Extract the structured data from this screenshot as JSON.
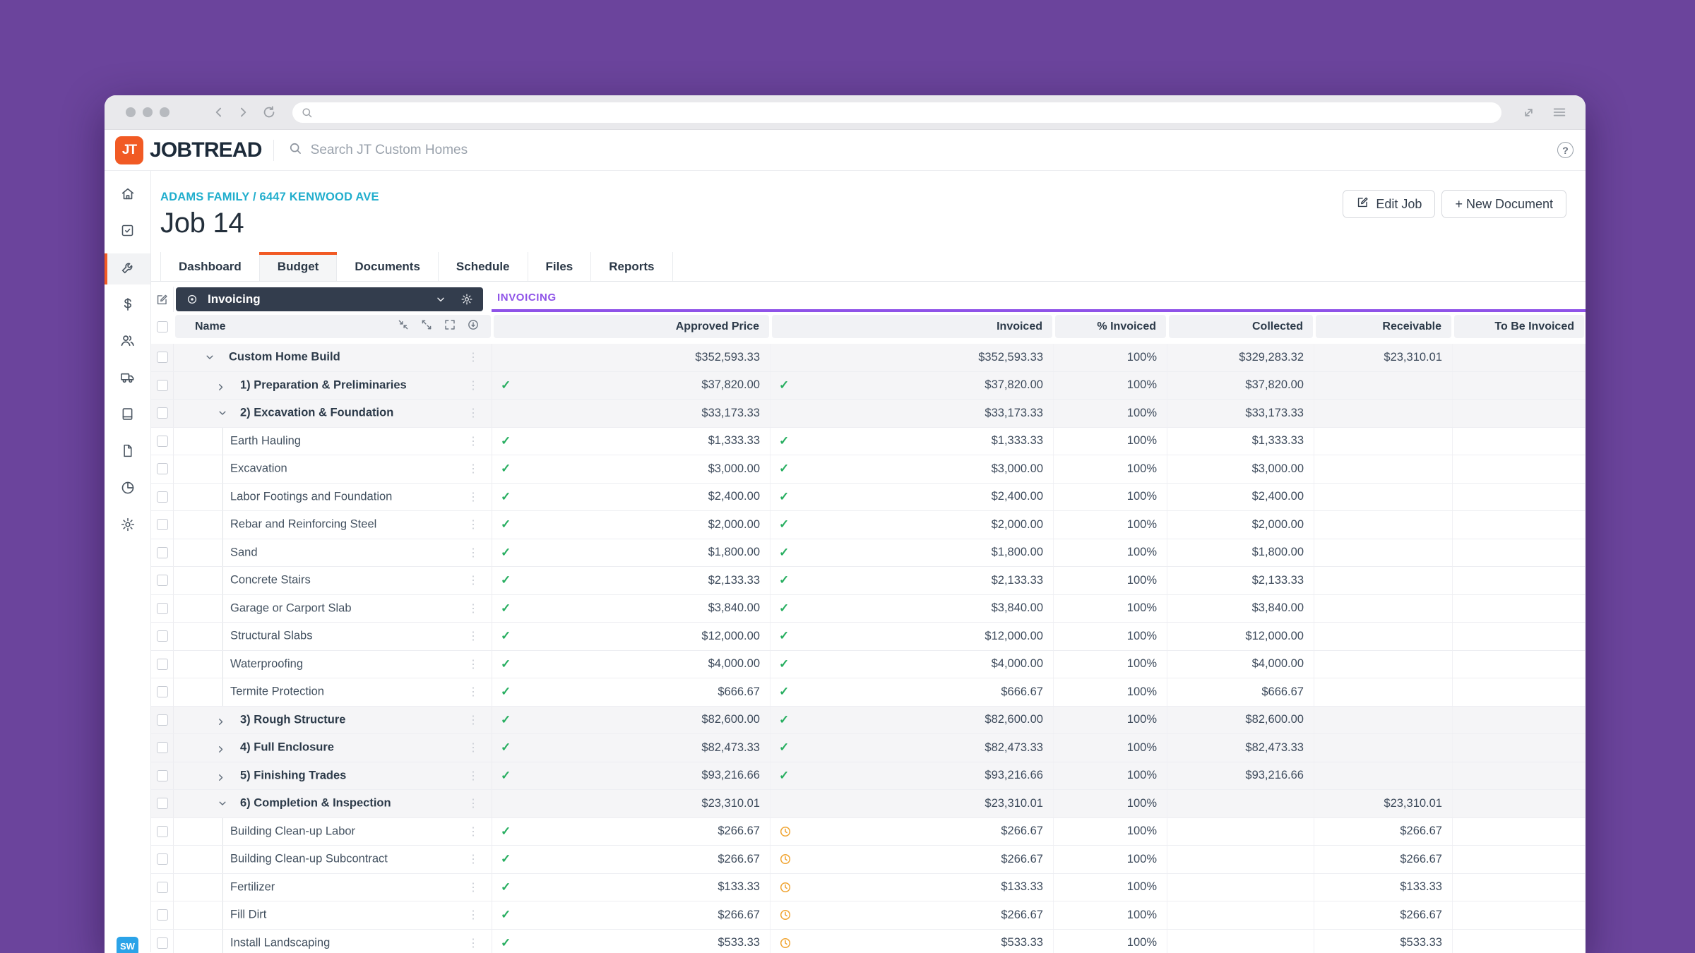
{
  "header": {
    "logo_mark": "JT",
    "logo_text_1": "JOB",
    "logo_text_2": "TREAD",
    "search_placeholder": "Search JT Custom Homes",
    "help_label": "?"
  },
  "job": {
    "breadcrumb": "ADAMS FAMILY / 6447 KENWOOD AVE",
    "title": "Job 14",
    "edit_button": "Edit Job",
    "new_document_button": "+ New Document"
  },
  "tabs": [
    {
      "label": "Dashboard",
      "active": false
    },
    {
      "label": "Budget",
      "active": true
    },
    {
      "label": "Documents",
      "active": false
    },
    {
      "label": "Schedule",
      "active": false
    },
    {
      "label": "Files",
      "active": false
    },
    {
      "label": "Reports",
      "active": false
    }
  ],
  "budget_toolbar": {
    "view_name": "Invoicing",
    "section_label": "INVOICING"
  },
  "sidebar": {
    "user_badge": "SW"
  },
  "table": {
    "name_header": "Name",
    "columns": [
      "Approved Price",
      "Invoiced",
      "% Invoiced",
      "Collected",
      "Receivable",
      "To Be Invoiced"
    ],
    "rows": [
      {
        "name": "Custom Home Build",
        "depth": 0,
        "group": true,
        "expanded": "down",
        "approved": "$352,593.33",
        "approved_billed": false,
        "invoiced": "$352,593.33",
        "invoiced_state": null,
        "pct_invoiced": "100%",
        "collected": "$329,283.32",
        "receivable": "$23,310.01",
        "to_be_invoiced": ""
      },
      {
        "name": "1) Preparation & Preliminaries",
        "depth": 1,
        "group": true,
        "expanded": "right",
        "approved": "$37,820.00",
        "approved_billed": true,
        "invoiced": "$37,820.00",
        "invoiced_state": "paid",
        "pct_invoiced": "100%",
        "collected": "$37,820.00",
        "receivable": "",
        "to_be_invoiced": ""
      },
      {
        "name": "2) Excavation & Foundation",
        "depth": 1,
        "group": true,
        "expanded": "down",
        "approved": "$33,173.33",
        "approved_billed": false,
        "invoiced": "$33,173.33",
        "invoiced_state": null,
        "pct_invoiced": "100%",
        "collected": "$33,173.33",
        "receivable": "",
        "to_be_invoiced": ""
      },
      {
        "name": "Earth Hauling",
        "depth": 2,
        "group": false,
        "expanded": null,
        "approved": "$1,333.33",
        "approved_billed": true,
        "invoiced": "$1,333.33",
        "invoiced_state": "paid",
        "pct_invoiced": "100%",
        "collected": "$1,333.33",
        "receivable": "",
        "to_be_invoiced": ""
      },
      {
        "name": "Excavation",
        "depth": 2,
        "group": false,
        "expanded": null,
        "approved": "$3,000.00",
        "approved_billed": true,
        "invoiced": "$3,000.00",
        "invoiced_state": "paid",
        "pct_invoiced": "100%",
        "collected": "$3,000.00",
        "receivable": "",
        "to_be_invoiced": ""
      },
      {
        "name": "Labor Footings and Foundation",
        "depth": 2,
        "group": false,
        "expanded": null,
        "approved": "$2,400.00",
        "approved_billed": true,
        "invoiced": "$2,400.00",
        "invoiced_state": "paid",
        "pct_invoiced": "100%",
        "collected": "$2,400.00",
        "receivable": "",
        "to_be_invoiced": ""
      },
      {
        "name": "Rebar and Reinforcing Steel",
        "depth": 2,
        "group": false,
        "expanded": null,
        "approved": "$2,000.00",
        "approved_billed": true,
        "invoiced": "$2,000.00",
        "invoiced_state": "paid",
        "pct_invoiced": "100%",
        "collected": "$2,000.00",
        "receivable": "",
        "to_be_invoiced": ""
      },
      {
        "name": "Sand",
        "depth": 2,
        "group": false,
        "expanded": null,
        "approved": "$1,800.00",
        "approved_billed": true,
        "invoiced": "$1,800.00",
        "invoiced_state": "paid",
        "pct_invoiced": "100%",
        "collected": "$1,800.00",
        "receivable": "",
        "to_be_invoiced": ""
      },
      {
        "name": "Concrete Stairs",
        "depth": 2,
        "group": false,
        "expanded": null,
        "approved": "$2,133.33",
        "approved_billed": true,
        "invoiced": "$2,133.33",
        "invoiced_state": "paid",
        "pct_invoiced": "100%",
        "collected": "$2,133.33",
        "receivable": "",
        "to_be_invoiced": ""
      },
      {
        "name": "Garage or Carport Slab",
        "depth": 2,
        "group": false,
        "expanded": null,
        "approved": "$3,840.00",
        "approved_billed": true,
        "invoiced": "$3,840.00",
        "invoiced_state": "paid",
        "pct_invoiced": "100%",
        "collected": "$3,840.00",
        "receivable": "",
        "to_be_invoiced": ""
      },
      {
        "name": "Structural Slabs",
        "depth": 2,
        "group": false,
        "expanded": null,
        "approved": "$12,000.00",
        "approved_billed": true,
        "invoiced": "$12,000.00",
        "invoiced_state": "paid",
        "pct_invoiced": "100%",
        "collected": "$12,000.00",
        "receivable": "",
        "to_be_invoiced": ""
      },
      {
        "name": "Waterproofing",
        "depth": 2,
        "group": false,
        "expanded": null,
        "approved": "$4,000.00",
        "approved_billed": true,
        "invoiced": "$4,000.00",
        "invoiced_state": "paid",
        "pct_invoiced": "100%",
        "collected": "$4,000.00",
        "receivable": "",
        "to_be_invoiced": ""
      },
      {
        "name": "Termite Protection",
        "depth": 2,
        "group": false,
        "expanded": null,
        "approved": "$666.67",
        "approved_billed": true,
        "invoiced": "$666.67",
        "invoiced_state": "paid",
        "pct_invoiced": "100%",
        "collected": "$666.67",
        "receivable": "",
        "to_be_invoiced": ""
      },
      {
        "name": "3) Rough Structure",
        "depth": 1,
        "group": true,
        "expanded": "right",
        "approved": "$82,600.00",
        "approved_billed": true,
        "invoiced": "$82,600.00",
        "invoiced_state": "paid",
        "pct_invoiced": "100%",
        "collected": "$82,600.00",
        "receivable": "",
        "to_be_invoiced": ""
      },
      {
        "name": "4) Full Enclosure",
        "depth": 1,
        "group": true,
        "expanded": "right",
        "approved": "$82,473.33",
        "approved_billed": true,
        "invoiced": "$82,473.33",
        "invoiced_state": "paid",
        "pct_invoiced": "100%",
        "collected": "$82,473.33",
        "receivable": "",
        "to_be_invoiced": ""
      },
      {
        "name": "5) Finishing Trades",
        "depth": 1,
        "group": true,
        "expanded": "right",
        "approved": "$93,216.66",
        "approved_billed": true,
        "invoiced": "$93,216.66",
        "invoiced_state": "paid",
        "pct_invoiced": "100%",
        "collected": "$93,216.66",
        "receivable": "",
        "to_be_invoiced": ""
      },
      {
        "name": "6) Completion & Inspection",
        "depth": 1,
        "group": true,
        "expanded": "down",
        "approved": "$23,310.01",
        "approved_billed": false,
        "invoiced": "$23,310.01",
        "invoiced_state": null,
        "pct_invoiced": "100%",
        "collected": "",
        "receivable": "$23,310.01",
        "to_be_invoiced": ""
      },
      {
        "name": "Building Clean-up Labor",
        "depth": 2,
        "group": false,
        "expanded": null,
        "approved": "$266.67",
        "approved_billed": true,
        "invoiced": "$266.67",
        "invoiced_state": "pending",
        "pct_invoiced": "100%",
        "collected": "",
        "receivable": "$266.67",
        "to_be_invoiced": ""
      },
      {
        "name": "Building Clean-up Subcontract",
        "depth": 2,
        "group": false,
        "expanded": null,
        "approved": "$266.67",
        "approved_billed": true,
        "invoiced": "$266.67",
        "invoiced_state": "pending",
        "pct_invoiced": "100%",
        "collected": "",
        "receivable": "$266.67",
        "to_be_invoiced": ""
      },
      {
        "name": "Fertilizer",
        "depth": 2,
        "group": false,
        "expanded": null,
        "approved": "$133.33",
        "approved_billed": true,
        "invoiced": "$133.33",
        "invoiced_state": "pending",
        "pct_invoiced": "100%",
        "collected": "",
        "receivable": "$133.33",
        "to_be_invoiced": ""
      },
      {
        "name": "Fill Dirt",
        "depth": 2,
        "group": false,
        "expanded": null,
        "approved": "$266.67",
        "approved_billed": true,
        "invoiced": "$266.67",
        "invoiced_state": "pending",
        "pct_invoiced": "100%",
        "collected": "",
        "receivable": "$266.67",
        "to_be_invoiced": ""
      },
      {
        "name": "Install Landscaping",
        "depth": 2,
        "group": false,
        "expanded": null,
        "approved": "$533.33",
        "approved_billed": true,
        "invoiced": "$533.33",
        "invoiced_state": "pending",
        "pct_invoiced": "100%",
        "collected": "",
        "receivable": "$533.33",
        "to_be_invoiced": ""
      }
    ]
  },
  "colors": {
    "brand_orange": "#f15a24",
    "accent_purple": "#8f53e8",
    "link_cyan": "#21aecd",
    "check_green": "#27ae60",
    "pending_orange": "#f0a431",
    "background_purple": "#6b449c",
    "dropdown_dark": "#333d4d"
  }
}
